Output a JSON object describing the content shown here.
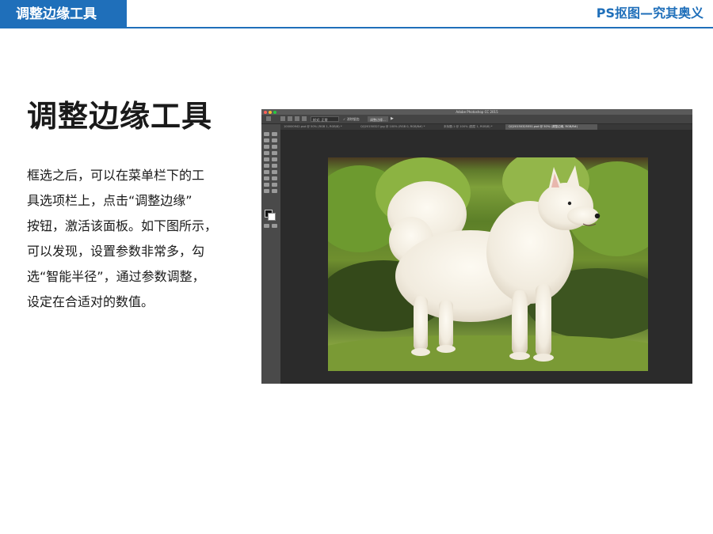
{
  "header": {
    "section_tab": "调整边缘工具",
    "course_title": "PS抠图—究其奥义"
  },
  "main": {
    "title": "调整边缘工具",
    "paragraph_lines": [
      "框选之后，可以在菜单栏下的工",
      "具选项栏上，点击“调整边缘”",
      "按钮，激活该面板。如下图所示，",
      "可以发现，设置参数非常多，勾",
      "选“智能半径”，通过参数调整，",
      "设定在合适对的数值。"
    ]
  },
  "screenshot": {
    "app_title": "Adobe Photoshop CC 2015",
    "options": {
      "style_field": "样式: 正常",
      "checkbox": "✓ 消除锯齿",
      "refine_button": "调整边缘..."
    },
    "documents": [
      "100000942.psd @ 50% (RGB 1, RGB/8) *",
      "QQ20150327.jpg @ 100% (RGB 0, RGB/8#) *",
      "未标题-1 @ 100% (图层 1, RGB/8) *",
      "QQ20150325551.psd @ 50% (调整边缘, RGB/8#)"
    ],
    "active_document_index": 3,
    "image_subject": "white-samoyed-dog-on-grass"
  },
  "colors": {
    "brand_blue": "#1f6fba",
    "ps_dark": "#2a2a2a",
    "ps_close": "#ff5f57",
    "ps_min": "#febc2e",
    "ps_max": "#28c840"
  }
}
